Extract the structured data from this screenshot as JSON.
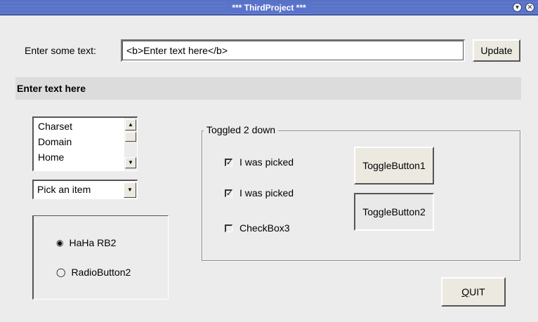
{
  "window": {
    "title": "*** ThirdProject ***",
    "menu_icon": "window-menu-icon",
    "close_icon": "close-icon"
  },
  "input_row": {
    "label": "Enter some text:",
    "value": "<b>Enter text here</b>",
    "update_button": "Update"
  },
  "banner": {
    "text": "Enter text here"
  },
  "listbox": {
    "items": [
      "Charset",
      "Domain",
      "Home"
    ]
  },
  "combo": {
    "selected": "Pick an item"
  },
  "radio_group": {
    "options": [
      {
        "label": "HaHa RB2",
        "selected": true
      },
      {
        "label": "RadioButton2",
        "selected": false
      }
    ]
  },
  "toggle_group": {
    "title": "Toggled 2 down",
    "checkboxes": [
      {
        "label": "I was picked",
        "checked": true
      },
      {
        "label": "I was picked",
        "checked": true
      },
      {
        "label": "CheckBox3",
        "checked": false
      }
    ],
    "toggle_buttons": [
      {
        "label": "ToggleButton1",
        "pressed": false
      },
      {
        "label": "ToggleButton2",
        "pressed": true
      }
    ]
  },
  "quit_button": {
    "label_first": "Q",
    "label_rest": "UIT"
  }
}
